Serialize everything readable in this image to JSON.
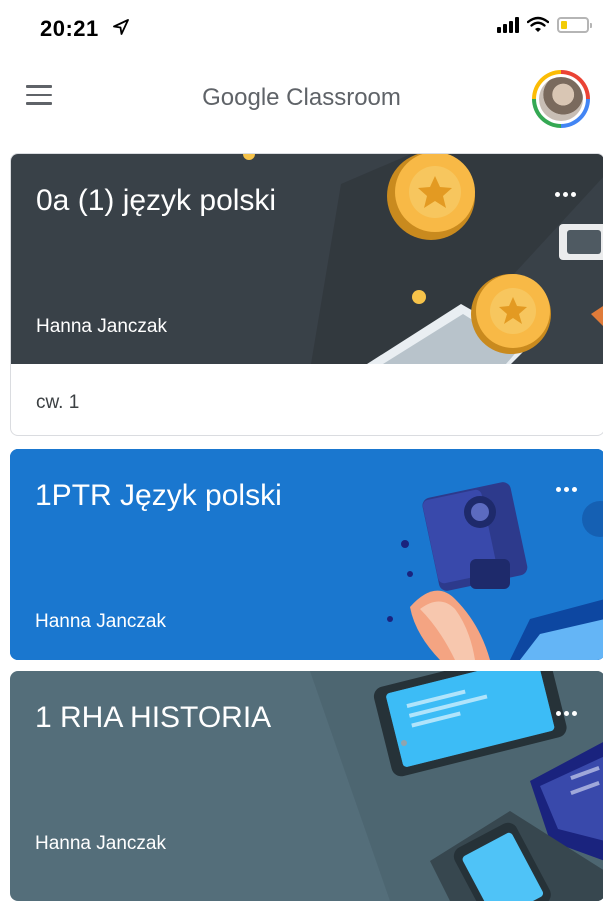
{
  "status_bar": {
    "time": "20:21",
    "location_icon": "location-arrow-icon",
    "signal_icon": "cellular-signal-icon",
    "wifi_icon": "wifi-icon",
    "battery_icon": "battery-low-icon",
    "battery_color": "#f2cb05"
  },
  "app_bar": {
    "title": "Google Classroom",
    "menu_icon": "hamburger-menu-icon",
    "avatar_ring_colors": [
      "#ea4335",
      "#4285f4",
      "#34a853",
      "#fbbc05"
    ]
  },
  "classes": [
    {
      "title": "0a (1) język polski",
      "teacher": "Hanna Janczak",
      "assignment": "cw. 1",
      "theme_color": "#394148",
      "banner": "medals-illustration"
    },
    {
      "title": "1PTR Język polski",
      "teacher": "Hanna Janczak",
      "theme_color": "#1a77cf",
      "banner": "writing-desk-illustration"
    },
    {
      "title": "1 RHA HISTORIA",
      "teacher": "Hanna Janczak",
      "theme_color": "#546e7a",
      "banner": "devices-illustration"
    }
  ]
}
